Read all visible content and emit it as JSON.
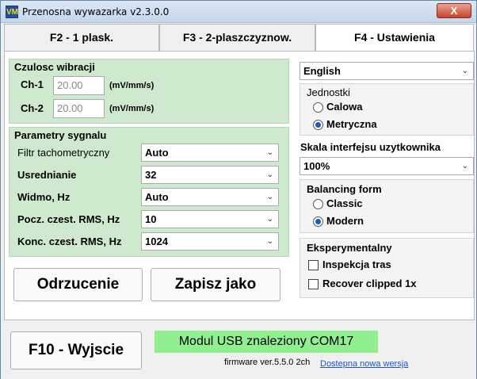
{
  "window": {
    "title": "Przenosna wywazarka v2.3.0.0",
    "app_icon_text": "VM",
    "close_glyph": "X"
  },
  "tabs": [
    {
      "label": "F2 - 1 plask."
    },
    {
      "label": "F3 - 2-plaszczyznow."
    },
    {
      "label": "F4 - Ustawienia"
    }
  ],
  "sensitivity": {
    "title": "Czulosc wibracji",
    "rows": [
      {
        "label": "Ch-1",
        "value": "20.00",
        "unit": "(mV/mm/s)"
      },
      {
        "label": "Ch-2",
        "value": "20.00",
        "unit": "(mV/mm/s)"
      }
    ]
  },
  "signal": {
    "title": "Parametry sygnalu",
    "rows": [
      {
        "label": "Filtr tachometryczny",
        "value": "Auto"
      },
      {
        "label": "Usrednianie",
        "value": "32"
      },
      {
        "label": "Widmo, Hz",
        "value": "Auto"
      },
      {
        "label": "Pocz. czest. RMS, Hz",
        "value": "10"
      },
      {
        "label": "Konc. czest. RMS, Hz",
        "value": "1024"
      }
    ]
  },
  "buttons": {
    "cancel": "Odrzucenie",
    "save_as": "Zapisz jako",
    "exit": "F10 - Wyjscie"
  },
  "language": {
    "value": "English"
  },
  "units": {
    "title": "Jednostki",
    "options": [
      "Calowa",
      "Metryczna"
    ],
    "selected": "Metryczna"
  },
  "scale": {
    "title": "Skala interfejsu uzytkownika",
    "value": "100%"
  },
  "balancing": {
    "title": "Balancing form",
    "options": [
      "Classic",
      "Modern"
    ],
    "selected": "Modern"
  },
  "experimental": {
    "title": "Eksperymentalny",
    "options": [
      "Inspekcja tras",
      "Recover clipped 1x"
    ]
  },
  "status": {
    "usb": "Modul USB znaleziony COM17",
    "firmware": "firmware ver.5.5.0 2ch",
    "update_link": "Dostepna nowa wersja",
    "usb_color": "#90f090"
  }
}
